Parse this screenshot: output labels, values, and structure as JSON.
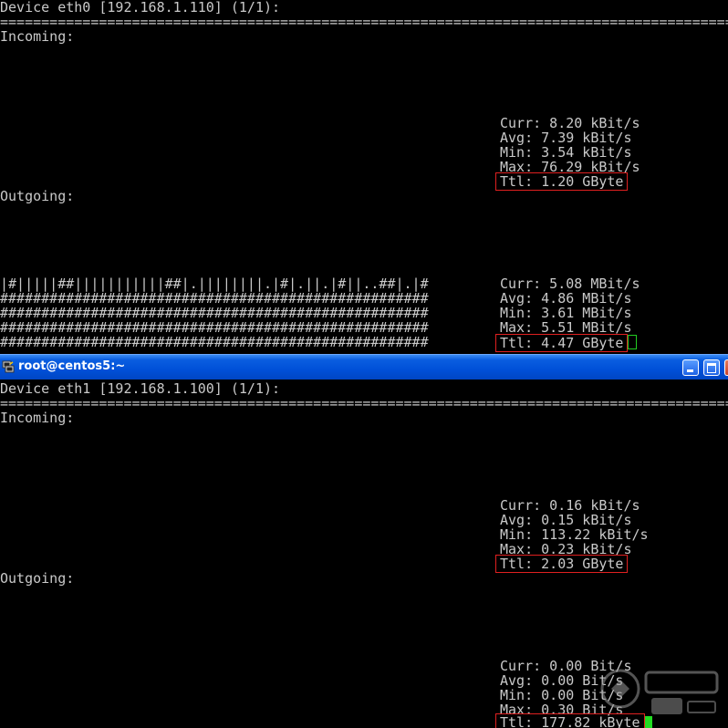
{
  "session_top": {
    "device_header": "Device eth0 [192.168.1.110] (1/1):",
    "separator": "================================================================================================================",
    "incoming": {
      "label": "Incoming:",
      "curr": "Curr: 8.20 kBit/s",
      "avg": "Avg: 7.39 kBit/s",
      "min": "Min: 3.54 kBit/s",
      "max": "Max: 76.29 kBit/s",
      "ttl": "Ttl: 1.20 GByte"
    },
    "outgoing": {
      "label": "Outgoing:",
      "graph_rows": [
        "|#|||||##|||||||||||##|.||||||||.|#|.||.|#||..##|.|#",
        "####################################################",
        "####################################################",
        "####################################################",
        "####################################################"
      ],
      "curr": "Curr: 5.08 MBit/s",
      "avg": "Avg: 4.86 MBit/s",
      "min": "Min: 3.61 MBit/s",
      "max": "Max: 5.51 MBit/s",
      "ttl": "Ttl: 4.47 GByte"
    }
  },
  "window": {
    "title": "root@centos5:~",
    "icon": "putty-terminal-icon"
  },
  "session_bottom": {
    "device_header": "Device eth1 [192.168.1.100] (1/1):",
    "separator": "================================================================================================================",
    "incoming": {
      "label": "Incoming:",
      "curr": "Curr: 0.16 kBit/s",
      "avg": "Avg: 0.15 kBit/s",
      "min": "Min: 113.22 kBit/s",
      "max": "Max: 0.23 kBit/s",
      "ttl": "Ttl: 2.03 GByte"
    },
    "outgoing": {
      "label": "Outgoing:",
      "curr": "Curr: 0.00 Bit/s",
      "avg": "Avg: 0.00 Bit/s",
      "min": "Min: 0.00 Bit/s",
      "max": "Max: 0.30 Bit/s",
      "ttl": "Ttl: 177.82 kByte"
    }
  },
  "colors": {
    "terminal_bg": "#000000",
    "terminal_fg": "#c9c9c9",
    "highlight_box": "#e02020",
    "cursor": "#22dd22",
    "titlebar": "#0050d8"
  }
}
